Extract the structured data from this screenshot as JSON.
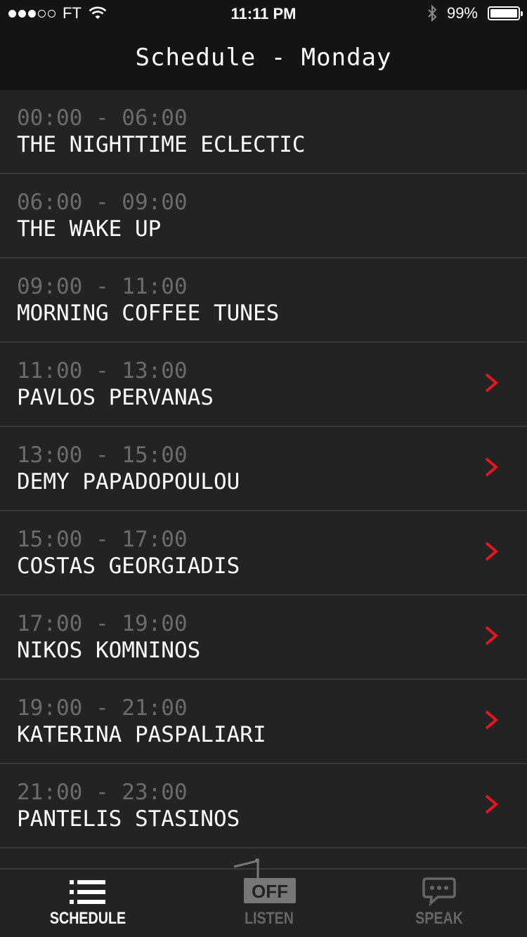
{
  "status_bar": {
    "carrier": "FT",
    "time": "11:11 PM",
    "battery": "99%",
    "battery_level": 0.99
  },
  "header": {
    "title": "Schedule - Monday"
  },
  "schedule": [
    {
      "time": "00:00 - 06:00",
      "show": "THE NIGHTTIME ECLECTIC",
      "has_detail": false
    },
    {
      "time": "06:00 - 09:00",
      "show": "THE WAKE UP",
      "has_detail": false
    },
    {
      "time": "09:00 - 11:00",
      "show": "MORNING COFFEE TUNES",
      "has_detail": false
    },
    {
      "time": "11:00 - 13:00",
      "show": "PAVLOS PERVANAS",
      "has_detail": true
    },
    {
      "time": "13:00 - 15:00",
      "show": "DEMY PAPADOPOULOU",
      "has_detail": true
    },
    {
      "time": "15:00 - 17:00",
      "show": "COSTAS GEORGIADIS",
      "has_detail": true
    },
    {
      "time": "17:00 - 19:00",
      "show": "NIKOS KOMNINOS",
      "has_detail": true
    },
    {
      "time": "19:00 - 21:00",
      "show": "KATERINA PASPALIARI",
      "has_detail": true
    },
    {
      "time": "21:00 - 23:00",
      "show": "PANTELIS STASINOS",
      "has_detail": true
    }
  ],
  "tabs": {
    "schedule": {
      "label": "SCHEDULE",
      "icon": "list-icon",
      "active": true
    },
    "listen": {
      "label": "LISTEN",
      "icon": "radio-off-icon",
      "badge": "OFF",
      "active": false
    },
    "speak": {
      "label": "SPEAK",
      "icon": "speech-bubble-icon",
      "active": false
    }
  },
  "colors": {
    "accent": "#e3171d",
    "background": "#232323",
    "bar": "#141414",
    "muted_text": "#6b6b6b"
  }
}
